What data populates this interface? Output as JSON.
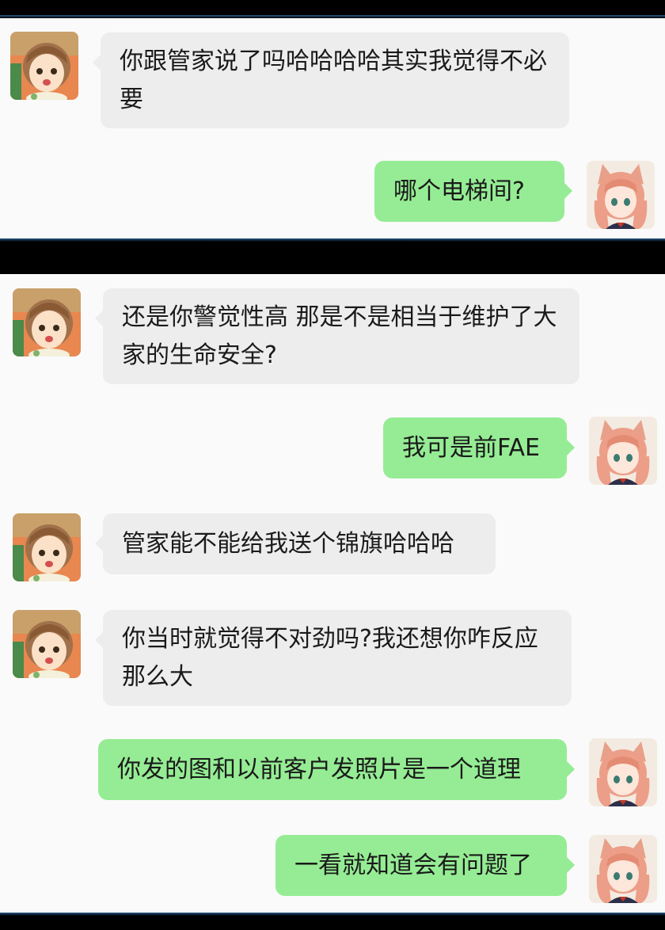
{
  "colors": {
    "left_bubble": "#ededed",
    "right_bubble": "#95ec94",
    "background": "#fafafa"
  },
  "panels": [
    {
      "messages": [
        {
          "side": "left",
          "text": "你跟管家说了吗哈哈哈哈其实我觉得不必要",
          "avatar": "girl-brown-hair-avatar"
        },
        {
          "side": "right",
          "text": "哪个电梯间?",
          "avatar": "catgirl-pink-hair-avatar"
        }
      ]
    },
    {
      "messages": [
        {
          "side": "left",
          "text": "还是你警觉性高 那是不是相当于维护了大家的生命安全?",
          "avatar": "girl-brown-hair-avatar"
        },
        {
          "side": "right",
          "text": "我可是前FAE",
          "avatar": "catgirl-pink-hair-avatar"
        },
        {
          "side": "left",
          "text": "管家能不能给我送个锦旗哈哈哈",
          "avatar": "girl-brown-hair-avatar"
        },
        {
          "side": "left",
          "text": "你当时就觉得不对劲吗?我还想你咋反应那么大",
          "avatar": "girl-brown-hair-avatar"
        },
        {
          "side": "right",
          "text": "你发的图和以前客户发照片是一个道理",
          "avatar": "catgirl-pink-hair-avatar"
        },
        {
          "side": "right",
          "text": "一看就知道会有问题了",
          "avatar": "catgirl-pink-hair-avatar"
        }
      ]
    }
  ]
}
